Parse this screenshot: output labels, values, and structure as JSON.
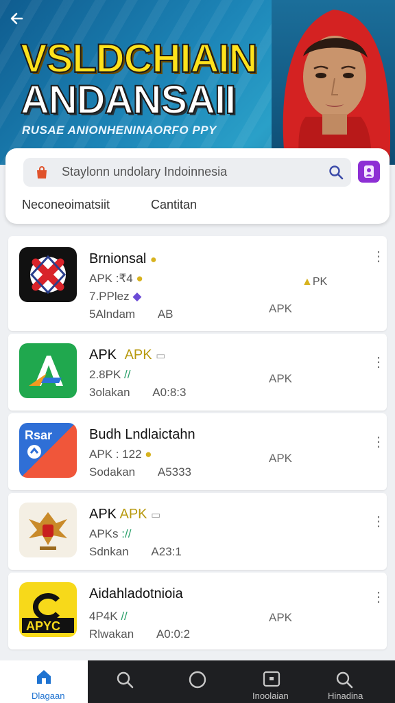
{
  "banner": {
    "title_line1": "VSLDCHIAIN",
    "title_line2": "ANDANSAII",
    "subtitle": "RUSAE ANIONHENINAORFO PPY"
  },
  "search": {
    "placeholder": "Staylonn undolary Indoinnesia",
    "filter_left": "Neconeoimatsiit",
    "filter_right": "Cantitan"
  },
  "apps": [
    {
      "name": "Brnionsal",
      "meta1": "APK :₹4",
      "meta2": "7.PPlez",
      "meta3": "5Alndam",
      "meta3b": "AB",
      "extra": "PK",
      "right": "APK"
    },
    {
      "name": "APK",
      "name_accent": "APK",
      "meta1": "2.8PK",
      "meta1b": "//",
      "meta3": "3olakan",
      "meta3b": "A0:8:3",
      "right": "APK"
    },
    {
      "name": "Budh Lndlaictahn",
      "meta1": "APK : 122",
      "meta3": "Sodakan",
      "meta3b": "A5333",
      "right": "APK",
      "icon_text": "Rsar"
    },
    {
      "name": "APK",
      "name_accent": "APK",
      "meta1": "APKs",
      "meta1b": "://",
      "meta3": "Sdnkan",
      "meta3b": "A23:1",
      "right": ""
    },
    {
      "name": "Aidahladotnioia",
      "meta1": "4P4K",
      "meta1b": "//",
      "meta3": "Rlwakan",
      "meta3b": "A0:0:2",
      "right": "APK",
      "icon_text": "APYC"
    }
  ],
  "nav": {
    "home_label": "Dlagaan",
    "label4": "Inoolaian",
    "label5": "Hinadina"
  },
  "colors": {
    "banner_blue": "#1d86b8",
    "title_yellow": "#ffe21c",
    "accent_purple": "#8d2fd4",
    "nav_dark": "#1e1f22",
    "home_blue": "#1f73d1"
  }
}
